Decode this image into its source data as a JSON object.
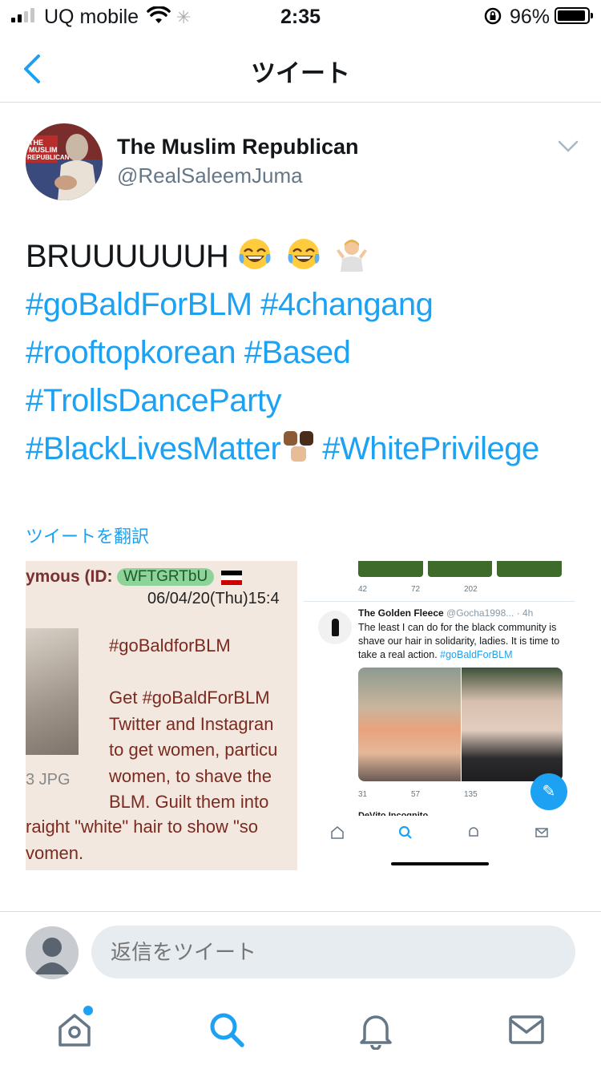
{
  "status_bar": {
    "carrier": "UQ mobile",
    "time": "2:35",
    "battery": "96%"
  },
  "nav": {
    "title": "ツイート"
  },
  "tweet": {
    "author_name": "The Muslim Republican",
    "author_handle": "@RealSaleemJuma",
    "text_main": "BRUUUUUUH",
    "hashtags": {
      "h1": "#goBaldForBLM",
      "h2": "#4changang",
      "h3": "#rooftopkorean",
      "h4": "#Based",
      "h5": "#TrollsDanceParty",
      "h6": "#BlackLivesMatter",
      "h7": "#WhitePrivilege"
    },
    "translate_label": "ツイートを翻訳"
  },
  "media_left": {
    "header": "ymous (ID:",
    "id": "WFTGRTbU",
    "date": "06/04/20(Thu)15:4",
    "jpg": "3 JPG",
    "lines": [
      "#goBaldforBLM",
      "",
      "Get #goBaldForBLM",
      "Twitter and Instagran",
      "to get women, particu",
      "women, to shave the",
      "BLM. Guilt them into"
    ],
    "bottom_lines": [
      "raight \"white\" hair to show \"so",
      "vomen."
    ]
  },
  "media_right": {
    "stats_top": [
      "42",
      "72",
      "202"
    ],
    "name": "The Golden Fleece",
    "handle": "@Gocha1998... · 4h",
    "text": "The least I can do for the black community is shave our hair in solidarity, ladies. It is time to take a real action.",
    "tag": "#goBaldForBLM",
    "stats_bottom": [
      "31",
      "57",
      "135"
    ],
    "next": "DeVito Incognito"
  },
  "reply": {
    "placeholder": "返信をツイート"
  },
  "colors": {
    "accent": "#1da1f2",
    "text": "#14171a",
    "secondary": "#657786"
  }
}
